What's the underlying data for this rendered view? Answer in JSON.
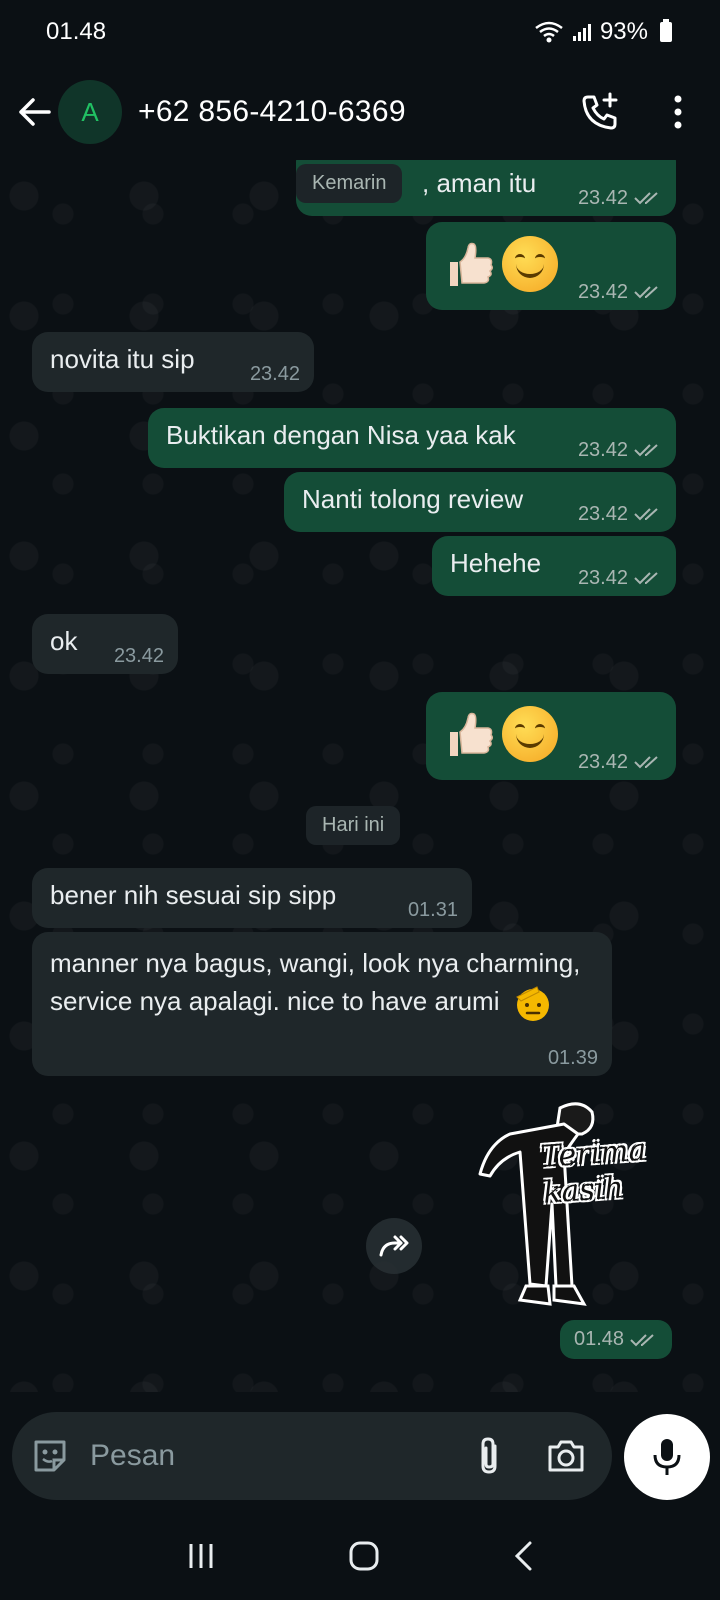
{
  "status_bar": {
    "time": "01.48",
    "battery": "93%"
  },
  "header": {
    "avatar_letter": "A",
    "contact": "+62 856-4210-6369"
  },
  "messages": [
    {
      "text": "‌, aman itu",
      "time": "23.42"
    },
    {
      "time": "23.42"
    },
    {
      "text": "novita itu sip",
      "time": "23.42"
    },
    {
      "text": "Buktikan dengan Nisa yaa kak",
      "time": "23.42"
    },
    {
      "text": "Nanti tolong review",
      "time": "23.42"
    },
    {
      "text": "Hehehe",
      "time": "23.42"
    },
    {
      "text": "ok",
      "time": "23.42"
    },
    {
      "time": "23.42"
    },
    {
      "text": "bener nih sesuai sip sipp",
      "time": "01.31"
    },
    {
      "text": "manner nya bagus, wangi, look nya charming, service nya apalagi. nice to have arumi",
      "time": "01.39"
    },
    {
      "time": "01.48"
    }
  ],
  "dates": {
    "yesterday": "Kemarin",
    "today": "Hari ini"
  },
  "sticker": {
    "text": "Terima kasih"
  },
  "composer": {
    "placeholder": "Pesan"
  },
  "colors": {
    "outgoing": "#144d37",
    "incoming": "#1f272a",
    "accent": "#21c063"
  }
}
